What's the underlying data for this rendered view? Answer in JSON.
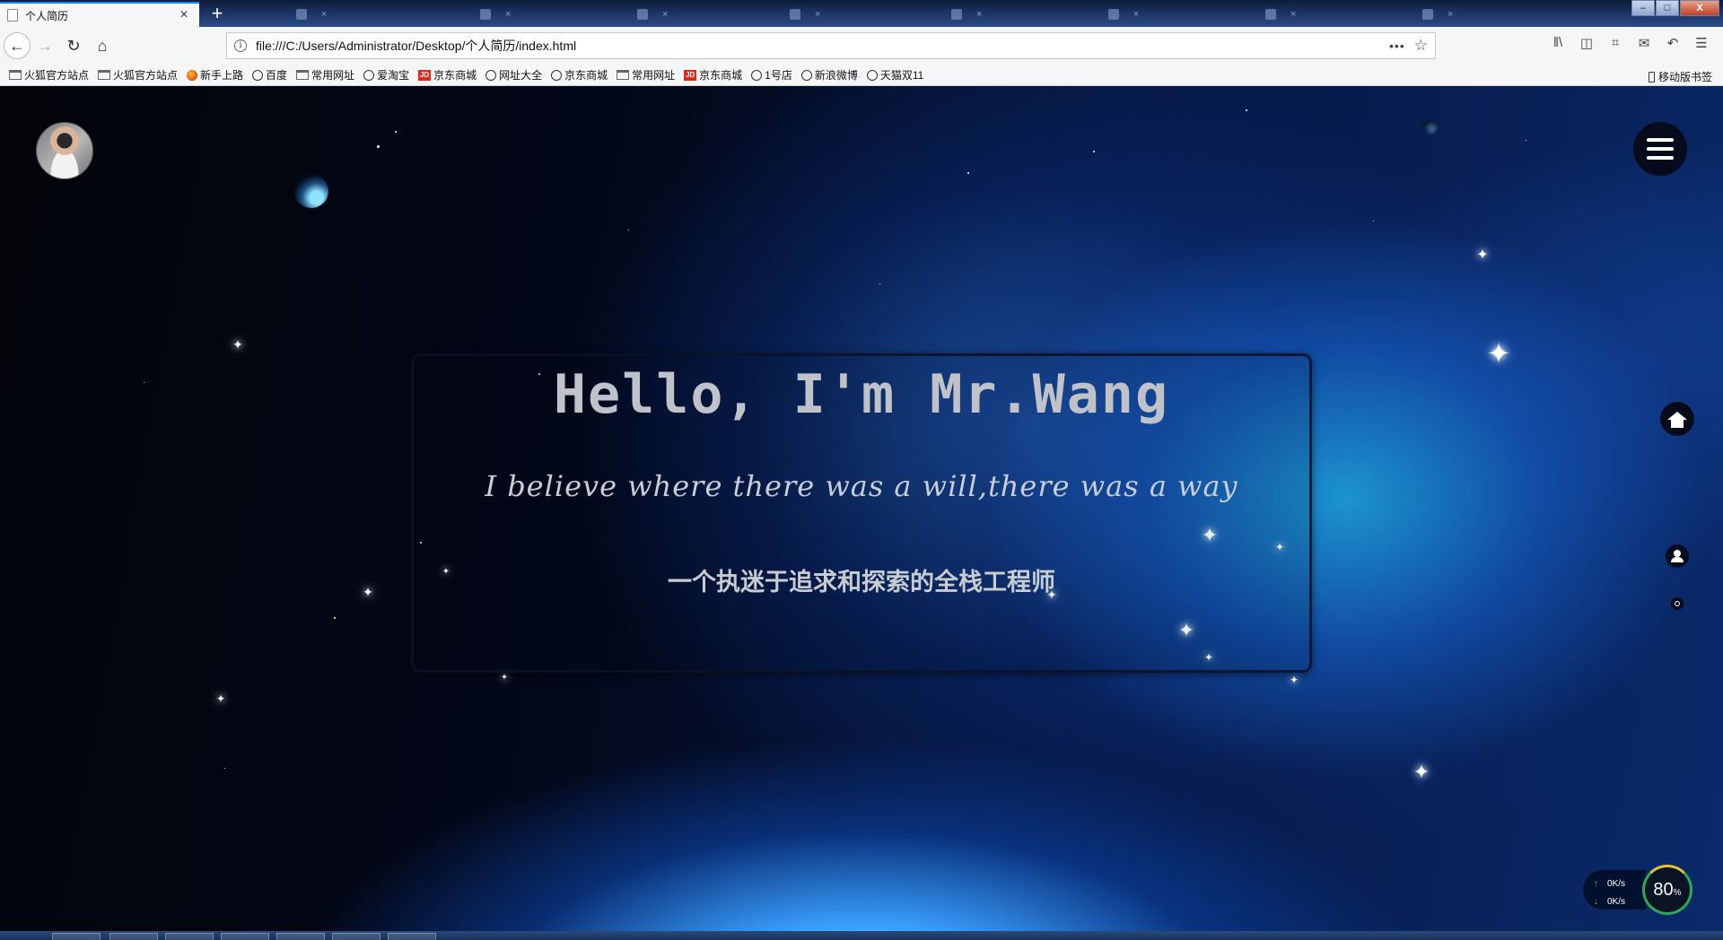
{
  "browser": {
    "active_tab_title": "个人简历",
    "background_tabs": [
      "",
      "",
      "",
      "",
      "",
      "",
      "",
      ""
    ],
    "url": "file:///C:/Users/Administrator/Desktop/个人简历/index.html",
    "more_label": "•••",
    "window_controls": {
      "minimize": "–",
      "maximize": "□",
      "close": "X"
    }
  },
  "bookmarks": [
    {
      "label": "火狐官方站点",
      "icon": "folder-icon"
    },
    {
      "label": "火狐官方站点",
      "icon": "folder-icon"
    },
    {
      "label": "新手上路",
      "icon": "firefox-icon"
    },
    {
      "label": "百度",
      "icon": "globe-icon"
    },
    {
      "label": "常用网址",
      "icon": "folder-icon"
    },
    {
      "label": "爱淘宝",
      "icon": "globe-icon"
    },
    {
      "label": "京东商城",
      "icon": "jd-icon"
    },
    {
      "label": "网址大全",
      "icon": "globe-icon"
    },
    {
      "label": "京东商城",
      "icon": "globe-icon"
    },
    {
      "label": "常用网址",
      "icon": "folder-icon"
    },
    {
      "label": "京东商城",
      "icon": "jd-icon"
    },
    {
      "label": "1号店",
      "icon": "globe-icon"
    },
    {
      "label": "新浪微博",
      "icon": "globe-icon"
    },
    {
      "label": "天猫双11",
      "icon": "globe-icon"
    }
  ],
  "mobile_bookmarks_label": "移动版书签",
  "jd_badge": "JD",
  "page": {
    "hero_title": "Hello, I'm Mr.Wang",
    "hero_motto": "I believe where there was a will,there was a way",
    "hero_tagline": "一个执迷于追求和探索的全栈工程师"
  },
  "net_widget": {
    "upload_speed": "0K/s",
    "download_speed": "0K/s",
    "percent": "80",
    "percent_unit": "%"
  },
  "colors": {
    "card_border": "#0a1224",
    "title_text": "#bfc3c9",
    "accent_blue": "#0a84ff"
  }
}
